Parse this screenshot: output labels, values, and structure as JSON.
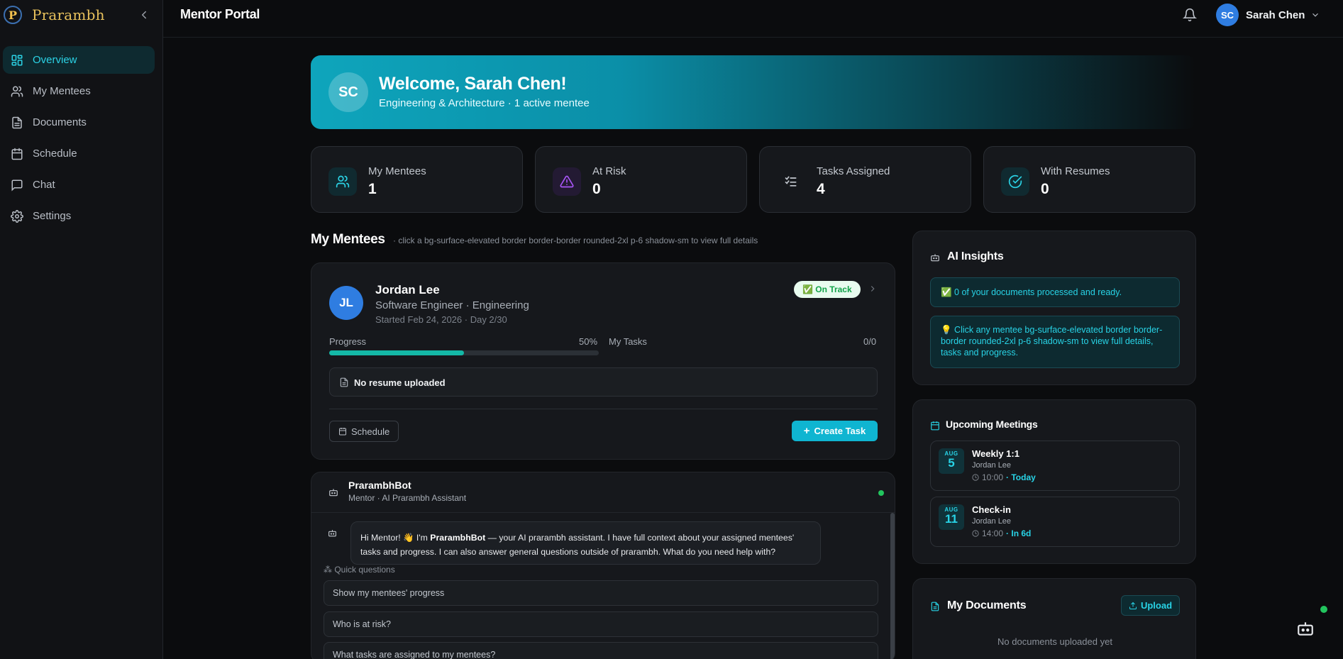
{
  "brand": {
    "logo_letter": "P",
    "name": "Prarambh"
  },
  "sidebar": {
    "items": [
      {
        "label": "Overview",
        "icon": "dashboard-icon",
        "active": true
      },
      {
        "label": "My Mentees",
        "icon": "users-icon"
      },
      {
        "label": "Documents",
        "icon": "document-icon"
      },
      {
        "label": "Schedule",
        "icon": "calendar-icon"
      },
      {
        "label": "Chat",
        "icon": "chat-icon"
      },
      {
        "label": "Settings",
        "icon": "gear-icon"
      }
    ]
  },
  "topbar": {
    "title": "Mentor Portal",
    "user": {
      "initials": "SC",
      "name": "Sarah Chen"
    }
  },
  "hero": {
    "initials": "SC",
    "title": "Welcome, Sarah Chen!",
    "subtitle": "Engineering & Architecture · 1 active mentee"
  },
  "stats": [
    {
      "label": "My Mentees",
      "value": "1",
      "icon": "users-icon",
      "color": "#2bd3e6"
    },
    {
      "label": "At Risk",
      "value": "0",
      "icon": "warning-icon",
      "color": "#a855f7"
    },
    {
      "label": "Tasks Assigned",
      "value": "4",
      "icon": "checklist-icon",
      "color": "#c3c8cf"
    },
    {
      "label": "With Resumes",
      "value": "0",
      "icon": "check-circle-icon",
      "color": "#2bd3e6"
    }
  ],
  "mentees_section": {
    "title": "My Mentees",
    "hint": "· click a bg-surface-elevated border border-border rounded-2xl p-6 shadow-sm to view full details"
  },
  "mentee": {
    "initials": "JL",
    "name": "Jordan Lee",
    "role": "Software Engineer · Engineering",
    "started": "Started Feb 24, 2026 · Day 2/30",
    "status": "✅ On Track",
    "progress_label": "Progress",
    "progress_pct": "50%",
    "progress_value": 0.5,
    "tasks_label": "My Tasks",
    "tasks_value": "0/0",
    "resume": "No resume uploaded",
    "schedule_label": "Schedule",
    "create_task_label": "Create Task"
  },
  "bot": {
    "name": "PrarambhBot",
    "subtitle": "Mentor · AI Prarambh Assistant",
    "message_pre": "Hi Mentor! 👋 I'm ",
    "message_bold": "PrarambhBot",
    "message_post": " — your AI prarambh assistant. I have full context about your assigned mentees' tasks and progress. I can also answer general questions outside of prarambh. What do you need help with?",
    "quick_label": "Quick questions",
    "quick_questions": [
      "Show my mentees' progress",
      "Who is at risk?",
      "What tasks are assigned to my mentees?"
    ]
  },
  "insights": {
    "title": "AI Insights",
    "items": [
      "✅ 0 of your documents processed and ready.",
      "💡 Click any mentee bg-surface-elevated border border-border rounded-2xl p-6 shadow-sm to view full details, tasks and progress."
    ]
  },
  "meetings": {
    "title": "Upcoming Meetings",
    "items": [
      {
        "month": "AUG",
        "day": "5",
        "title": "Weekly 1:1",
        "who": "Jordan Lee",
        "time": "10:00",
        "relative": "· Today"
      },
      {
        "month": "AUG",
        "day": "11",
        "title": "Check-in",
        "who": "Jordan Lee",
        "time": "14:00",
        "relative": "· In 6d"
      }
    ]
  },
  "documents": {
    "title": "My Documents",
    "upload_label": "Upload",
    "empty": "No documents uploaded yet"
  }
}
